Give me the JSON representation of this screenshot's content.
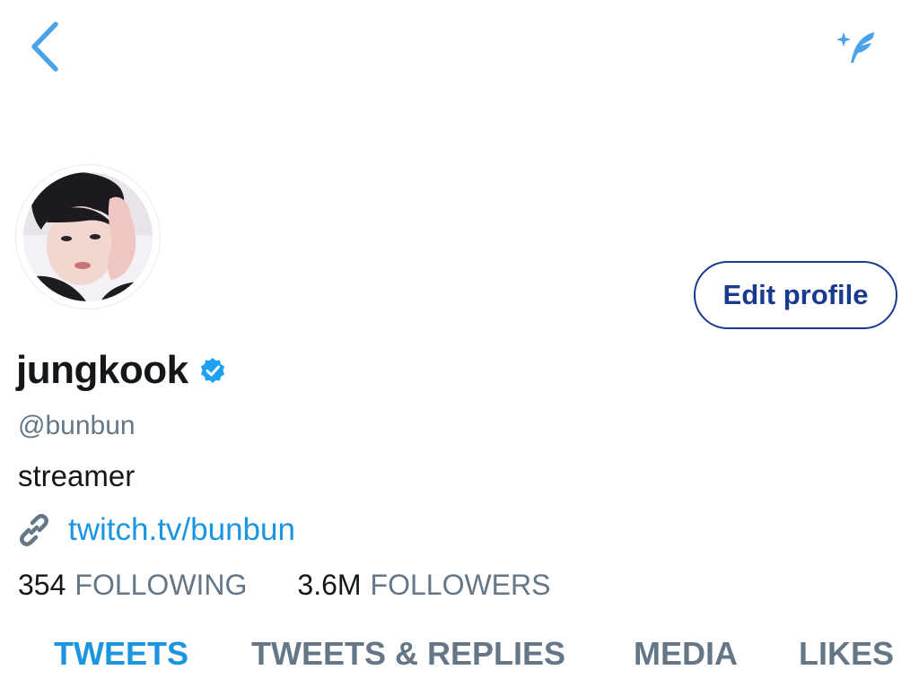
{
  "topbar": {
    "back_icon": "chevron-left-icon",
    "compose_icon": "sparkle-feather-icon"
  },
  "profile": {
    "display_name": "jungkook",
    "verified": true,
    "handle": "@bunbun",
    "bio": "streamer",
    "website": "twitch.tv/bunbun",
    "edit_button_label": "Edit profile"
  },
  "stats": {
    "following_count": "354",
    "following_label": "FOLLOWING",
    "followers_count": "3.6M",
    "followers_label": "FOLLOWERS"
  },
  "tabs": [
    {
      "label": "TWEETS",
      "active": true
    },
    {
      "label": "TWEETS & REPLIES",
      "active": false
    },
    {
      "label": "MEDIA",
      "active": false
    },
    {
      "label": "LIKES",
      "active": false
    }
  ],
  "colors": {
    "accent": "#1b95e0",
    "edit_button": "#1a3a8f",
    "secondary_text": "#657786",
    "primary_text": "#14171a"
  }
}
